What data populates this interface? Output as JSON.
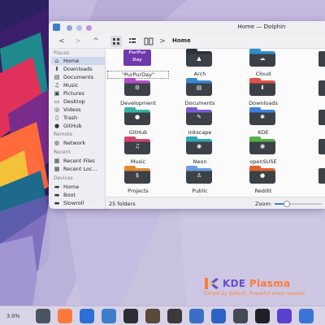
{
  "window": {
    "title": "Home — Dolphin",
    "breadcrumb": "Home"
  },
  "toolbar": {
    "back_icon": "<",
    "forward_icon": ">",
    "up_icon": "^",
    "sep_icon": ">"
  },
  "sidebar": {
    "places_title": "Places",
    "places": [
      {
        "label": "Home",
        "icon": "home-icon",
        "glyph": "⌂"
      },
      {
        "label": "Downloads",
        "icon": "download-icon",
        "glyph": "⬇"
      },
      {
        "label": "Documents",
        "icon": "documents-icon",
        "glyph": "▤"
      },
      {
        "label": "Music",
        "icon": "music-icon",
        "glyph": "♫"
      },
      {
        "label": "Pictures",
        "icon": "pictures-icon",
        "glyph": "▣"
      },
      {
        "label": "Desktop",
        "icon": "desktop-icon",
        "glyph": "▭"
      },
      {
        "label": "Videos",
        "icon": "videos-icon",
        "glyph": "◎"
      },
      {
        "label": "Trash",
        "icon": "trash-icon",
        "glyph": "▯"
      },
      {
        "label": "GitHub",
        "icon": "github-icon",
        "glyph": "●"
      }
    ],
    "remote_title": "Remote",
    "remote": [
      {
        "label": "Network",
        "icon": "network-icon",
        "glyph": "◍"
      }
    ],
    "recent_title": "Recent",
    "recent": [
      {
        "label": "Recent Files",
        "icon": "recent-files-icon",
        "glyph": "▦"
      },
      {
        "label": "Recent Loc...",
        "icon": "recent-locations-icon",
        "glyph": "▦"
      }
    ],
    "devices_title": "Devices",
    "devices": [
      {
        "label": "Home",
        "icon": "drive-icon",
        "glyph": "▬"
      },
      {
        "label": "Boot",
        "icon": "drive-icon",
        "glyph": "▬"
      },
      {
        "label": "Slowroll",
        "icon": "drive-icon",
        "glyph": "▬"
      }
    ]
  },
  "folders": [
    {
      "label": "\"PurPurDay\"",
      "special": "PurPur Day",
      "color": "#6d3aa8",
      "emblem": ""
    },
    {
      "label": "Arch",
      "color": "#3c4047",
      "tab": "#2d323a",
      "emblem": "▲"
    },
    {
      "label": "Cloud",
      "color": "#3c4047",
      "tab": "#2f8fc9",
      "emblem": "☁"
    },
    {
      "label": "Development",
      "color": "#3c4047",
      "tab": "#b24ec8",
      "emblem": "⚙"
    },
    {
      "label": "Documents",
      "color": "#3c4047",
      "tab": "#3a88cf",
      "emblem": "▤"
    },
    {
      "label": "Downloads",
      "color": "#3c4047",
      "tab": "#e0524a",
      "emblem": "⬇"
    },
    {
      "label": "GitHub",
      "color": "#3c4047",
      "tab": "#38b3a3",
      "emblem": "●"
    },
    {
      "label": "Inkscape",
      "color": "#3c4047",
      "tab": "#7a5cd6",
      "emblem": "✎"
    },
    {
      "label": "KDE",
      "color": "#3c4047",
      "tab": "#3f7fe0",
      "emblem": "✱"
    },
    {
      "label": "Music",
      "color": "#3c4047",
      "tab": "#d6426e",
      "emblem": "♫"
    },
    {
      "label": "Neon",
      "color": "#3c4047",
      "tab": "#2ea7b0",
      "emblem": "◉"
    },
    {
      "label": "openSUSE",
      "color": "#3c4047",
      "tab": "#55b04a",
      "emblem": "◉"
    },
    {
      "label": "Projects",
      "color": "#3c4047",
      "tab": "#e08a2e",
      "emblem": "$"
    },
    {
      "label": "Public",
      "color": "#3c4047",
      "tab": "#6a9be0",
      "emblem": "♙"
    },
    {
      "label": "Reddit",
      "color": "#3c4047",
      "tab": "#e0632e",
      "emblem": "●"
    }
  ],
  "status": {
    "folder_count": "25 folders",
    "zoom_label": "Zoom:",
    "zoom_level": 0.25
  },
  "branding": {
    "kde": "KDE",
    "plasma": "Plasma",
    "tagline": "Simple by default, Powerful when needed."
  },
  "taskbar": {
    "cpu": "3.0%",
    "apps": [
      {
        "name": "system-monitor-icon",
        "color": "#4a5563"
      },
      {
        "name": "firefox-icon",
        "color": "#ff7a3a"
      },
      {
        "name": "discover-icon",
        "color": "#2e6fd6"
      },
      {
        "name": "dolphin-icon",
        "color": "#3d7ec9"
      },
      {
        "name": "konsole-icon",
        "color": "#2b2e33"
      },
      {
        "name": "gimp-icon",
        "color": "#5a4a3a"
      },
      {
        "name": "inkscape-icon",
        "color": "#3a3a3a"
      },
      {
        "name": "kate-icon",
        "color": "#3b6ec7"
      },
      {
        "name": "kmail-icon",
        "color": "#2d63c8"
      },
      {
        "name": "settings-icon",
        "color": "#444a54"
      },
      {
        "name": "terminal-icon",
        "color": "#1e2024"
      },
      {
        "name": "store-icon",
        "color": "#5b3fd1"
      },
      {
        "name": "mail-icon",
        "color": "#3b74d6"
      }
    ]
  },
  "colors": {
    "accent": "#3d7ec9",
    "sidebar_active": "#cfd8ec",
    "window_bg": "#f4f4f6"
  }
}
